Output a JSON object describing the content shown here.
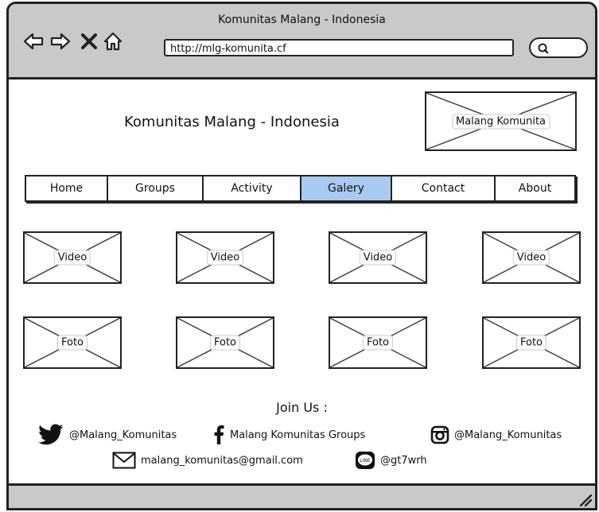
{
  "browser": {
    "window_title": "Komunitas Malang - Indonesia",
    "url": "http://mlg-komunita.cf",
    "icons": [
      "back-arrow-icon",
      "forward-arrow-icon",
      "stop-icon",
      "home-icon",
      "search-icon"
    ]
  },
  "header": {
    "site_title": "Komunitas Malang - Indonesia",
    "logo_label": "Malang Komunita"
  },
  "menu": {
    "items": [
      {
        "label": "Home"
      },
      {
        "label": "Groups"
      },
      {
        "label": "Activity"
      },
      {
        "label": "Galery",
        "active": true
      },
      {
        "label": "Contact"
      },
      {
        "label": "About"
      }
    ],
    "active_color": "#a9c9f1"
  },
  "gallery": {
    "videos": [
      "Video",
      "Video",
      "Video",
      "Video"
    ],
    "photos": [
      "Foto",
      "Foto",
      "Foto",
      "Foto"
    ]
  },
  "footer": {
    "join_label": "Join Us :",
    "twitter": "@Malang_Komunitas",
    "facebook": "Malang Komunitas Groups",
    "instagram": "@Malang_Komunitas",
    "email": "malang_komunitas@gmail.com",
    "line": "@gt7wrh",
    "line_icon_text": "LINE"
  }
}
